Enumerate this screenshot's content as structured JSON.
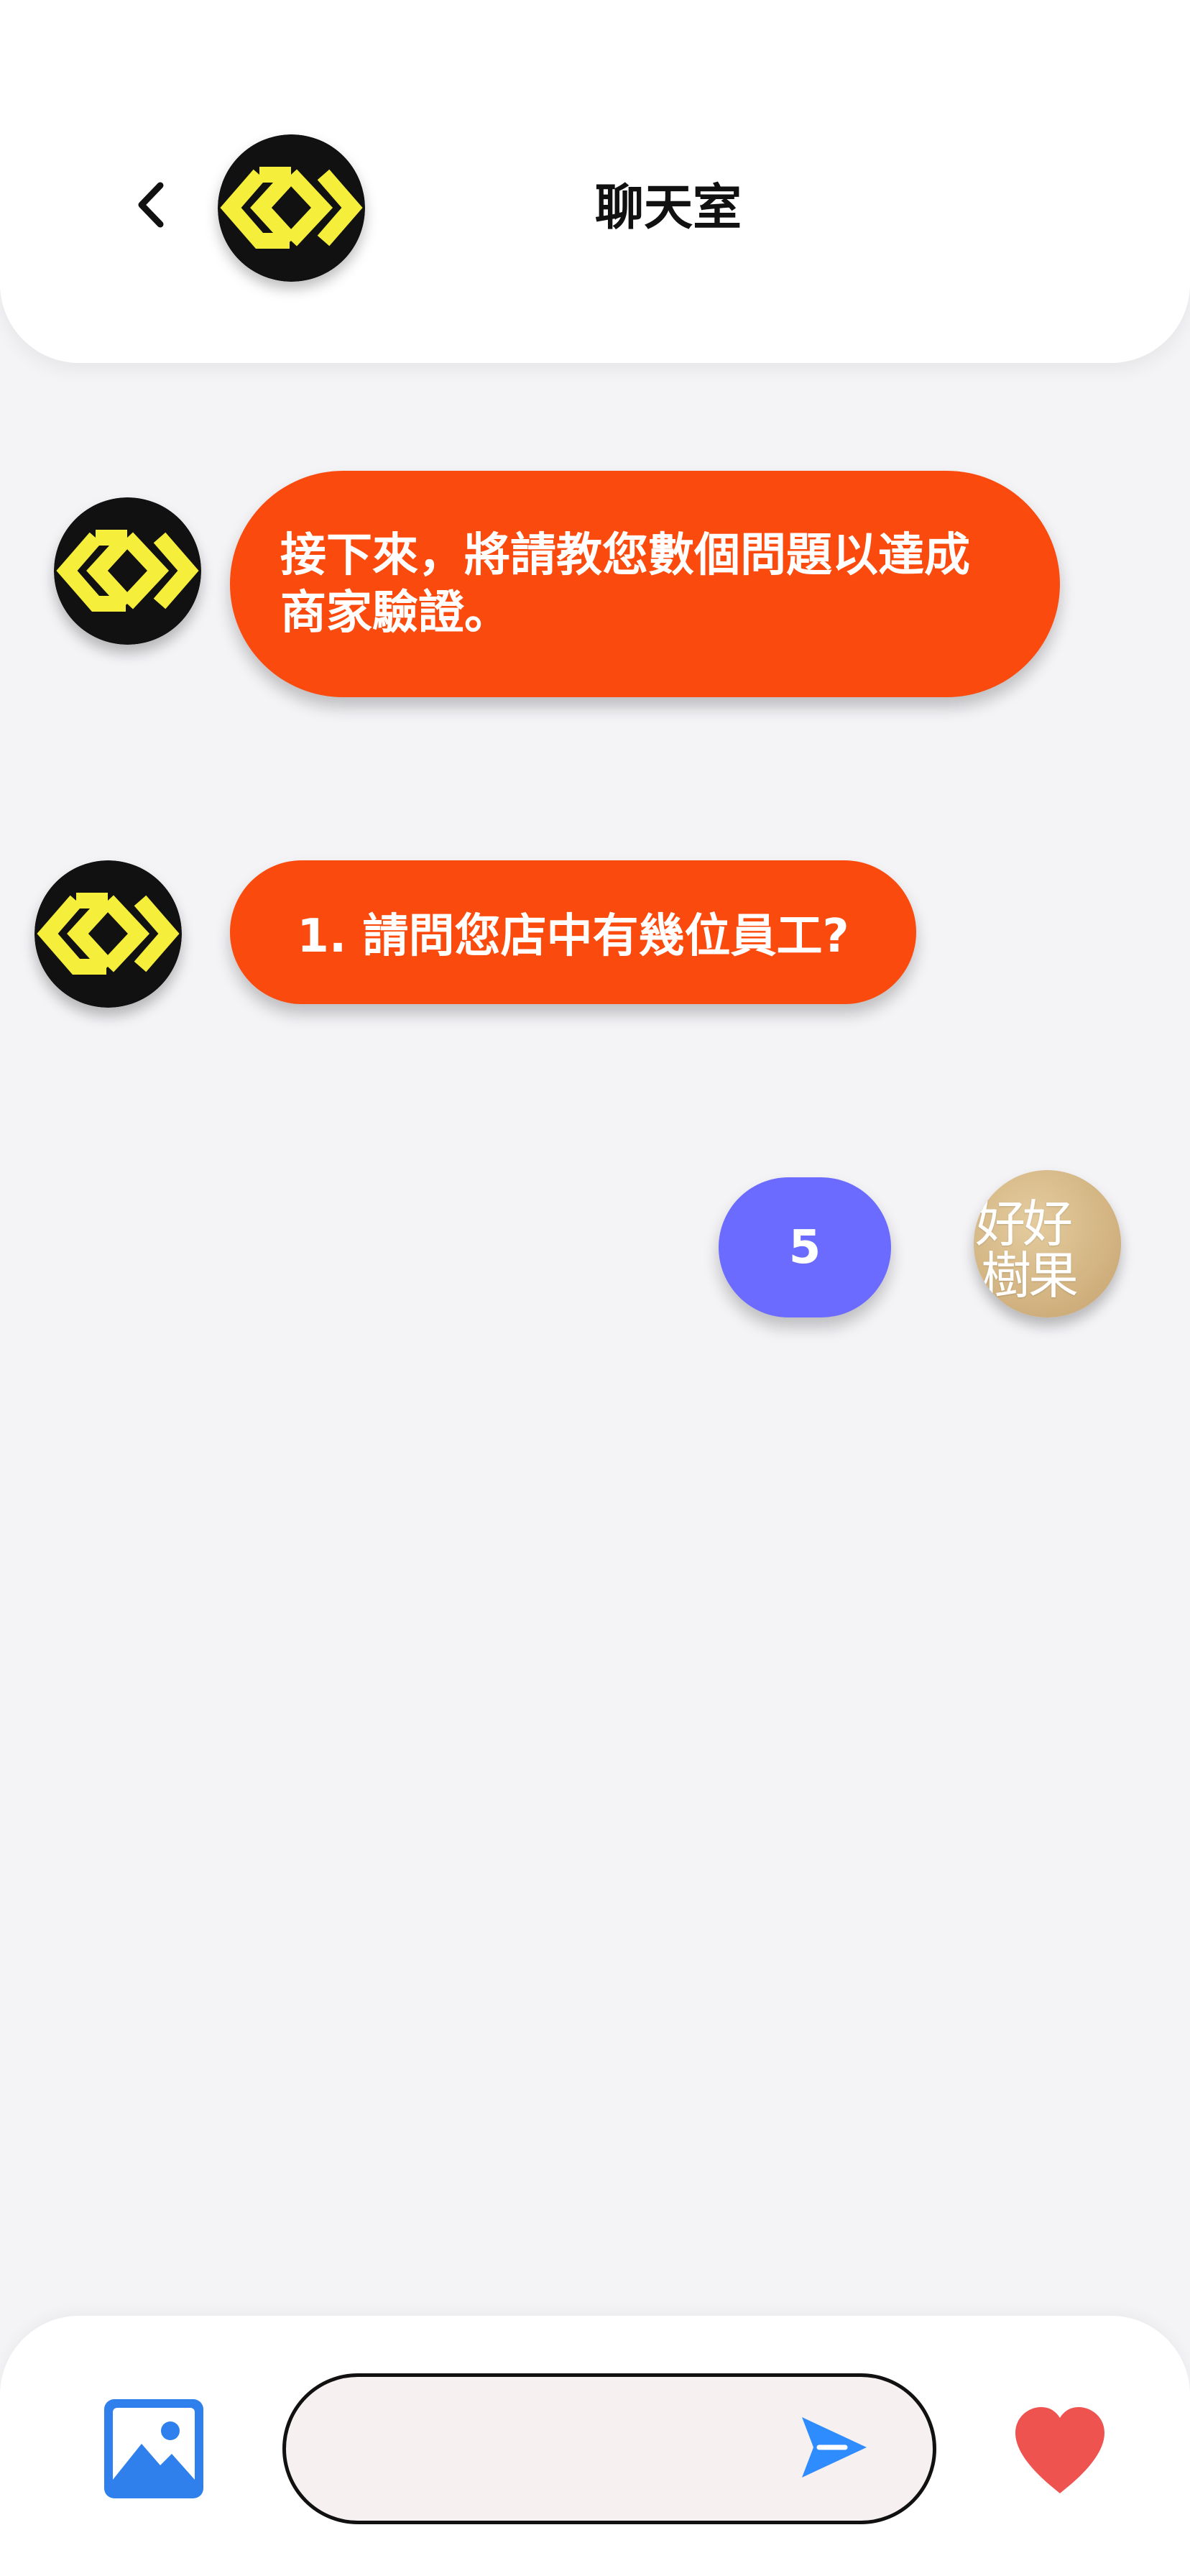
{
  "header": {
    "title": "聊天室"
  },
  "messages": [
    {
      "sender": "bot",
      "text_line1": "接下來，將請教您數個問題以達成",
      "text_line2": "商家驗證。"
    },
    {
      "sender": "bot",
      "text": "1. 請問您店中有幾位員工?"
    },
    {
      "sender": "user",
      "text": "5"
    }
  ],
  "user_avatar": {
    "line1": "好好",
    "line2": "樹果"
  },
  "composer": {
    "input_value": "",
    "placeholder": ""
  },
  "colors": {
    "bot_bubble": "#fb4a0d",
    "user_bubble": "#6b6bff",
    "send_icon": "#2f8cff",
    "image_icon": "#2f80ed",
    "heart_icon": "#ef5350",
    "logo_yellow": "#f5ee3a",
    "logo_black": "#111111"
  },
  "icons": {
    "back": "chevron-left-icon",
    "image": "image-icon",
    "send": "send-icon",
    "heart": "heart-icon"
  }
}
